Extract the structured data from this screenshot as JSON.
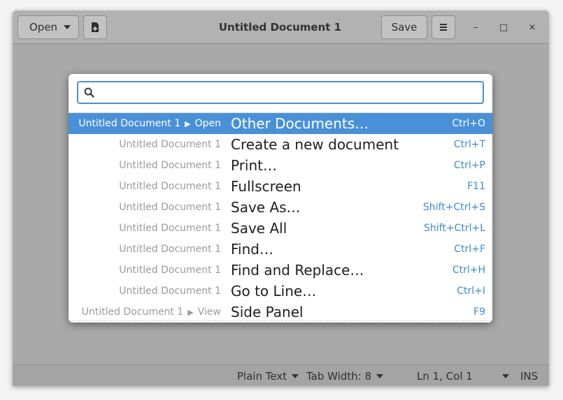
{
  "window": {
    "title": "Untitled Document 1"
  },
  "headerbar": {
    "open_label": "Open",
    "save_label": "Save",
    "icons": {
      "new_document": "new-document-icon",
      "menu": "hamburger-menu-icon",
      "minimize": "minimize-icon",
      "maximize": "maximize-icon",
      "close": "close-icon"
    },
    "window_controls": {
      "minimize": "–",
      "maximize": "□",
      "close": "×"
    }
  },
  "command_popup": {
    "search": {
      "value": "",
      "placeholder": ""
    },
    "rows": [
      {
        "context": "Untitled Document 1",
        "context_arrow": "▶",
        "context_sub": "Open",
        "label": "Other Documents…",
        "shortcut": "Ctrl+O",
        "selected": true
      },
      {
        "context": "Untitled Document 1",
        "label": "Create a new document",
        "shortcut": "Ctrl+T"
      },
      {
        "context": "Untitled Document 1",
        "label": "Print…",
        "shortcut": "Ctrl+P"
      },
      {
        "context": "Untitled Document 1",
        "label": "Fullscreen",
        "shortcut": "F11"
      },
      {
        "context": "Untitled Document 1",
        "label": "Save As…",
        "shortcut": "Shift+Ctrl+S"
      },
      {
        "context": "Untitled Document 1",
        "label": "Save All",
        "shortcut": "Shift+Ctrl+L"
      },
      {
        "context": "Untitled Document 1",
        "label": "Find…",
        "shortcut": "Ctrl+F"
      },
      {
        "context": "Untitled Document 1",
        "label": "Find and Replace…",
        "shortcut": "Ctrl+H"
      },
      {
        "context": "Untitled Document 1",
        "label": "Go to Line…",
        "shortcut": "Ctrl+I"
      },
      {
        "context": "Untitled Document 1",
        "context_arrow": "▶",
        "context_sub": "View",
        "label": "Side Panel",
        "shortcut": "F9"
      }
    ]
  },
  "statusbar": {
    "language": "Plain Text",
    "tab_width": "Tab Width: 8",
    "position": "Ln 1, Col 1",
    "insert_mode": "INS"
  },
  "colors": {
    "accent": "#4a90d9",
    "shortcut_text": "#3b8bd6"
  }
}
